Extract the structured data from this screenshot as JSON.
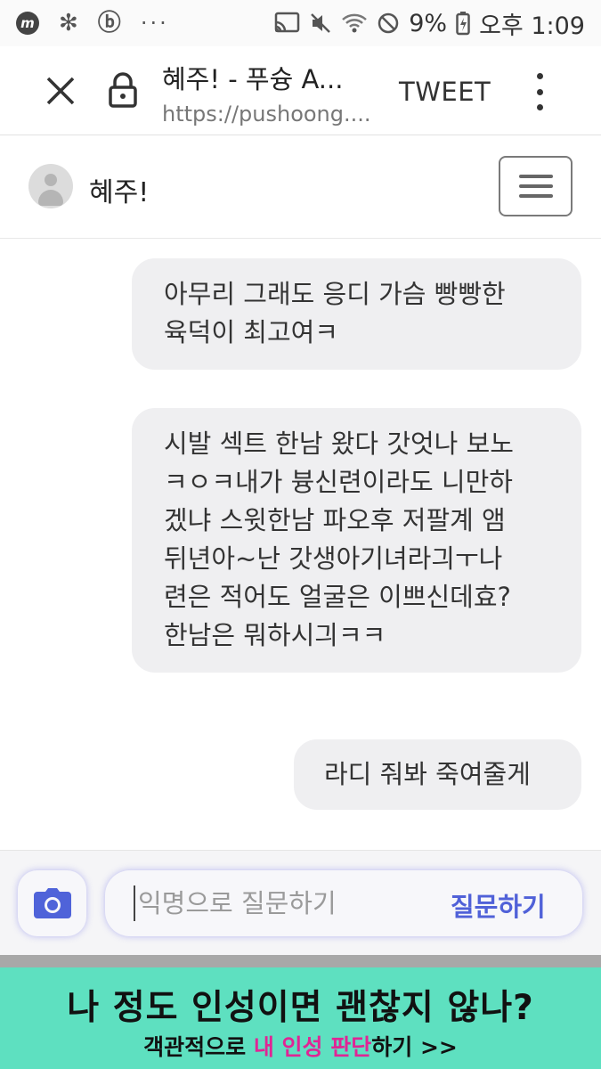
{
  "status_bar": {
    "app_icon_letter": "m",
    "battery": "9%",
    "time": "오후 1:09",
    "overflow": "···"
  },
  "browser": {
    "title": "혜주! - 푸슝 A...",
    "url": "https://pushoong....",
    "action_label": "TWEET"
  },
  "profile": {
    "name": "혜주!"
  },
  "messages": [
    {
      "text": "아무리 그래도 응디 가슴 빵빵한\n육덕이 최고여ㅋ"
    },
    {
      "text": "시발 섹트 한남 왔다 갓엇나 보노\nㅋㅇㅋ내가 븅신련이라도 니만하\n겠냐 스윗한남 파오후 저팔계 앰\n뒤년아~난 갓생아기녀라긔ㅜ나\n련은 적어도 얼굴은 이쁘신데효?\n한남은 뭐하시긔ㅋㅋ"
    },
    {
      "text": "라디 줘봐 죽여줄게"
    }
  ],
  "question": {
    "placeholder": "익명으로 질문하기",
    "submit_label": "질문하기"
  },
  "ad": {
    "title": "나 정도 인성이면 괜찮지 않나?",
    "subtitle_before": "객관적으로 ",
    "subtitle_highlight": "내 인성 판단",
    "subtitle_after": "하기 >>"
  },
  "colors": {
    "accent": "#5061d8",
    "bubble": "#efeff1",
    "ad_background": "#5ee0c0",
    "ad_highlight": "#e02595"
  }
}
